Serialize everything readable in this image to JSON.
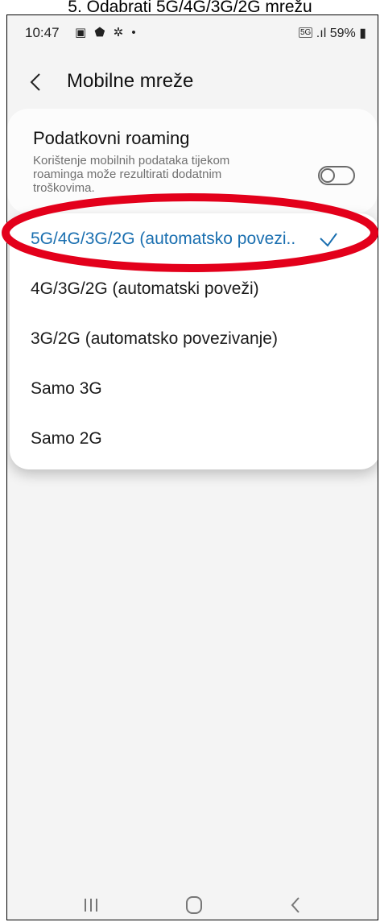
{
  "caption": "5.   Odabrati 5G/4G/3G/2G mrežu",
  "status_bar": {
    "time": "10:47",
    "left_icons": [
      "gallery-icon",
      "shield-icon",
      "settings-icon",
      "dot-icon"
    ],
    "network_badge": "5G",
    "battery": "59%"
  },
  "app_bar": {
    "title": "Mobilne mreže"
  },
  "roaming": {
    "title": "Podatkovni roaming",
    "description": "Korištenje mobilnih podataka tijekom roaminga može rezultirati dodatnim troškovima.",
    "enabled": false
  },
  "network_modes": {
    "options": [
      {
        "label": "5G/4G/3G/2G (automatsko povezi..",
        "selected": true
      },
      {
        "label": "4G/3G/2G (automatski poveži)",
        "selected": false
      },
      {
        "label": "3G/2G (automatsko povezivanje)",
        "selected": false
      },
      {
        "label": "Samo 3G",
        "selected": false
      },
      {
        "label": "Samo 2G",
        "selected": false
      }
    ]
  },
  "colors": {
    "accent": "#1a6fb0",
    "annotation_ellipse": "#e3001b",
    "background": "#f4f4f4"
  }
}
